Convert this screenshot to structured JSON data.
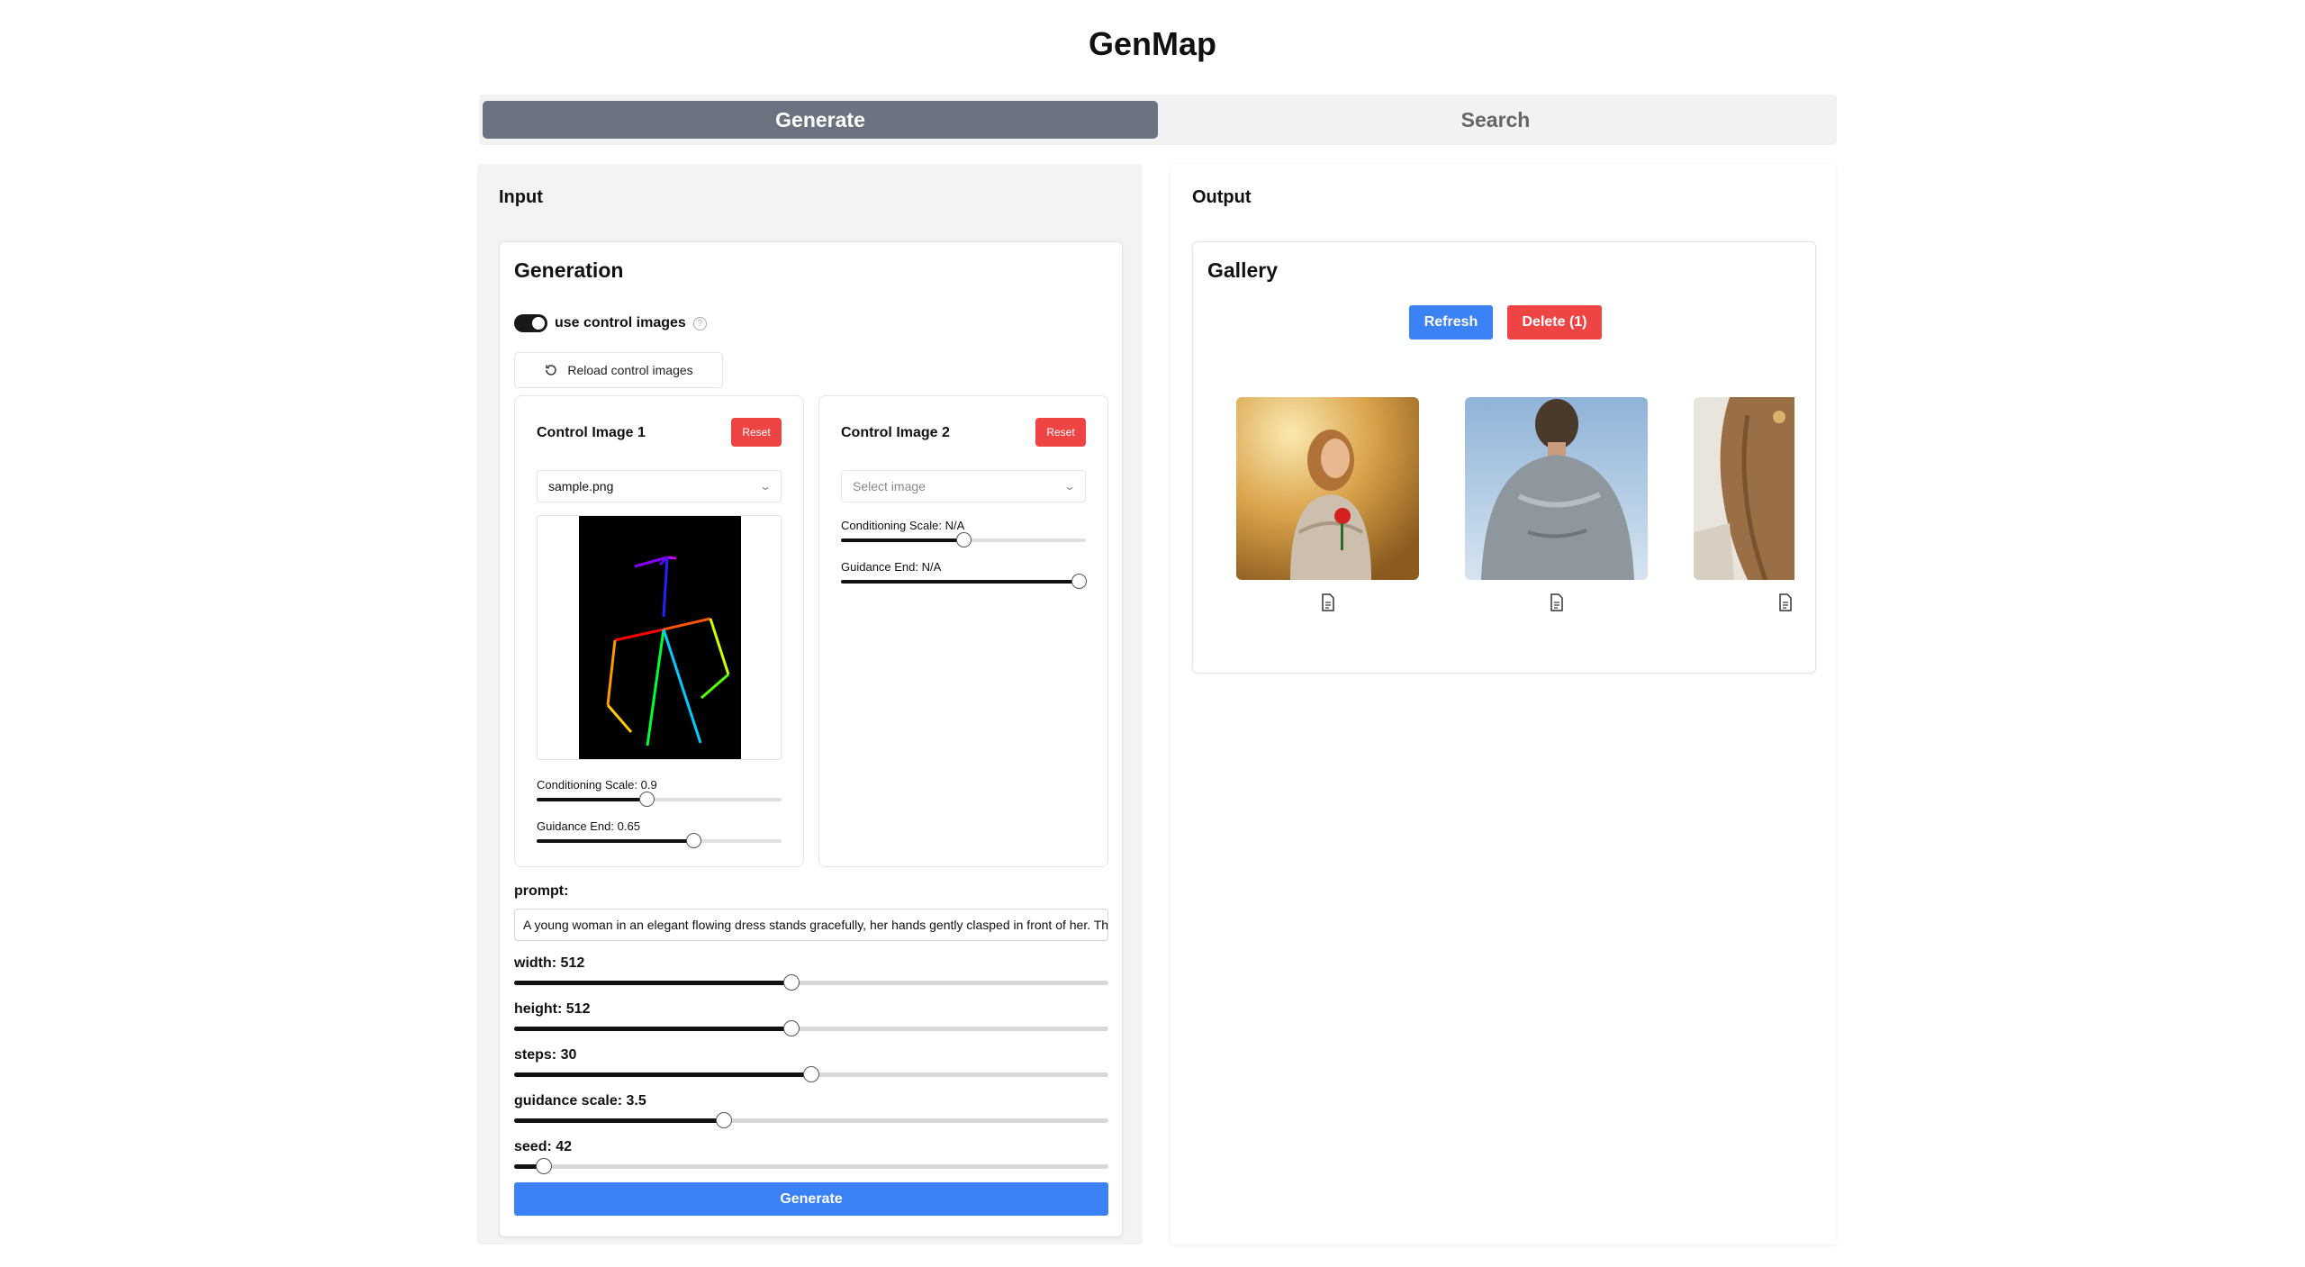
{
  "app": {
    "title": "GenMap"
  },
  "tabs": [
    {
      "label": "Generate",
      "active": true
    },
    {
      "label": "Search",
      "active": false
    }
  ],
  "input_panel": {
    "title": "Input",
    "generation": {
      "title": "Generation",
      "use_control_images": {
        "label": "use control images",
        "enabled": true
      },
      "reload_label": "Reload control images",
      "control_images": [
        {
          "title": "Control Image 1",
          "reset_label": "Reset",
          "selected": "sample.png",
          "conditioning_label": "Conditioning Scale: 0.9",
          "conditioning_value": 0.45,
          "guidance_end_label": "Guidance End: 0.65",
          "guidance_end_value": 0.64
        },
        {
          "title": "Control Image 2",
          "reset_label": "Reset",
          "placeholder": "Select image",
          "conditioning_label": "Conditioning Scale: N/A",
          "conditioning_value": 0.5,
          "guidance_end_label": "Guidance End: N/A",
          "guidance_end_value": 0.97
        }
      ],
      "prompt_label": "prompt:",
      "prompt_value": "A young woman in an elegant flowing dress stands gracefully, her hands gently clasped in front of her. The soft light",
      "sliders": [
        {
          "label": "width: 512",
          "fraction": 0.467
        },
        {
          "label": "height: 512",
          "fraction": 0.467
        },
        {
          "label": "steps: 30",
          "fraction": 0.5
        },
        {
          "label": "guidance scale: 3.5",
          "fraction": 0.353
        },
        {
          "label": "seed: 42",
          "fraction": 0.05
        }
      ],
      "generate_label": "Generate"
    }
  },
  "output_panel": {
    "title": "Output",
    "gallery": {
      "title": "Gallery",
      "refresh_label": "Refresh",
      "delete_label": "Delete (1)",
      "colors": {
        "primary": "#3b82f6",
        "danger": "#ef4444"
      },
      "items": [
        {
          "icon": "document-icon"
        },
        {
          "icon": "document-icon"
        },
        {
          "icon": "document-icon"
        }
      ]
    }
  }
}
